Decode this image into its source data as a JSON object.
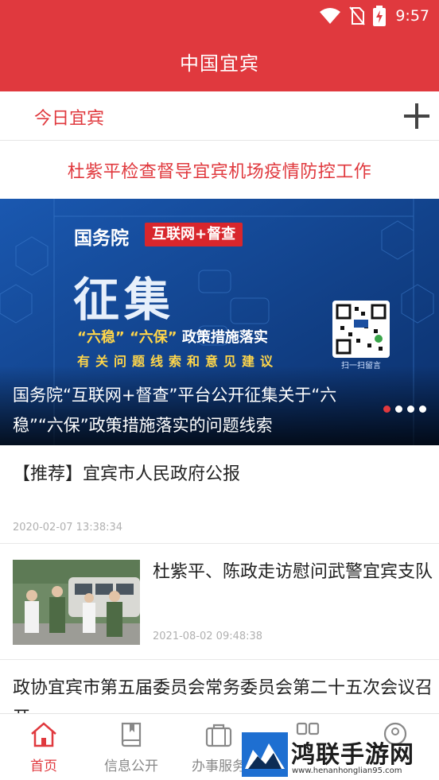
{
  "status_bar": {
    "time": "9:57",
    "icons": [
      "wifi-icon",
      "no-sim-icon",
      "battery-charging-icon"
    ]
  },
  "header": {
    "title": "中国宜宾"
  },
  "channels": {
    "active_tab": "今日宜宾",
    "add_icon": "plus-icon"
  },
  "headline": {
    "text": "杜紫平检查督导宜宾机场疫情防控工作"
  },
  "banner": {
    "org": "国务院",
    "tag": "互联网+督查",
    "big_text": "征集",
    "sub_line_quote1": "“六稳”",
    "sub_line_quote2": "“六保”",
    "sub_line_rest": "政策措施落实",
    "sub_line2": "有关问题线索和意见建议",
    "qr_caption": "扫一扫留言",
    "caption": "国务院“互联网+督查”平台公开征集关于“六稳”“六保”政策措施落实的问题线索",
    "slide_count": 4,
    "active_slide": 1
  },
  "feed": [
    {
      "title": "【推荐】宜宾市人民政府公报",
      "time": "2020-02-07 13:38:34"
    },
    {
      "title": "杜紫平、陈政走访慰问武警宜宾支队",
      "time": "2021-08-02 09:48:38",
      "thumb_icon": "news-photo"
    },
    {
      "title": "政协宜宾市第五届委员会常务委员会第二十五次会议召开"
    }
  ],
  "bottom_nav": [
    {
      "label": "首页",
      "icon": "home-icon",
      "active": true
    },
    {
      "label": "信息公开",
      "icon": "book-icon",
      "active": false
    },
    {
      "label": "办事服务",
      "icon": "briefcase-icon",
      "active": false
    },
    {
      "label": "",
      "icon": "grid-icon",
      "active": false
    },
    {
      "label": "",
      "icon": "user-icon",
      "active": false
    }
  ],
  "watermark": {
    "text": "鸿联手游网",
    "url": "www.henanhonglian95.com"
  },
  "colors": {
    "brand_red": "#e0393e",
    "banner_blue": "#0d3a7e",
    "highlight_yellow": "#ffd64a"
  }
}
